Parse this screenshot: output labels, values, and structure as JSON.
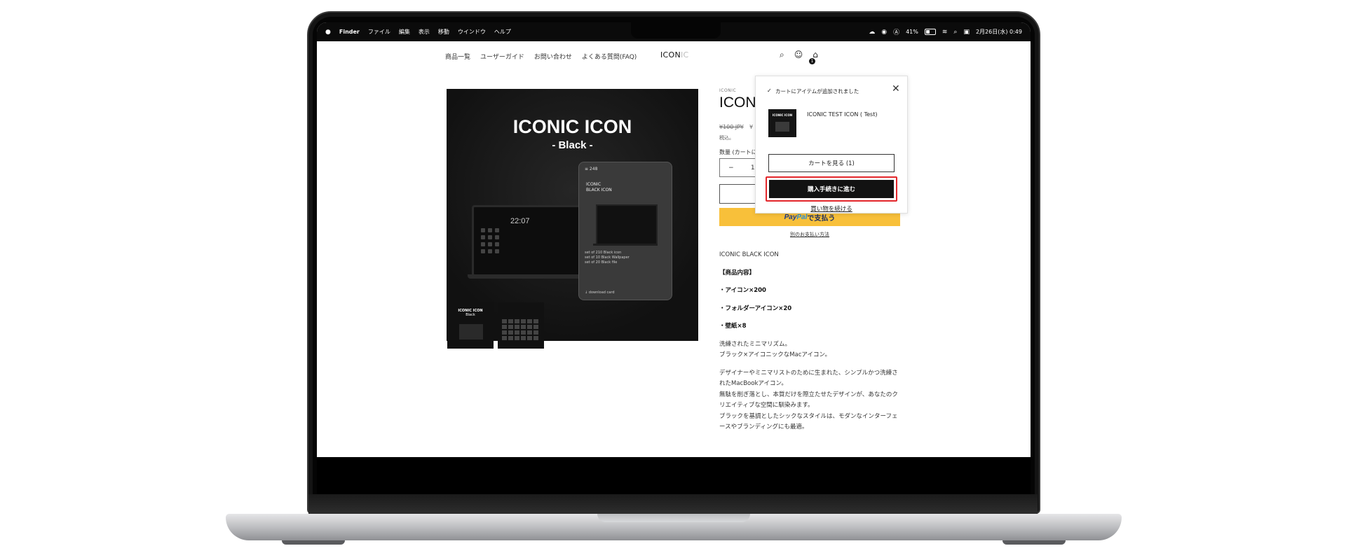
{
  "menubar": {
    "app": "Finder",
    "menus": [
      "ファイル",
      "編集",
      "表示",
      "移動",
      "ウインドウ",
      "ヘルプ"
    ],
    "battery": "41%",
    "datetime": "2月26日(水) 0:49"
  },
  "header": {
    "nav": [
      "商品一覧",
      "ユーザーガイド",
      "お問い合わせ",
      "よくある質問(FAQ)"
    ],
    "logo_main": "ICON",
    "logo_faded": "IC",
    "cart_count": "1"
  },
  "product_image": {
    "title": "ICONIC ICON",
    "subtitle": "- Black -",
    "mac_time": "22:07",
    "phone_top": "≡ 248",
    "phone_label_1": "ICONIC",
    "phone_label_2": "BLACK ICON",
    "phone_line_1": "set of 210 Black icon",
    "phone_line_2": "set of 10 Black Wallpaper",
    "phone_line_3": "set of 20 Black file",
    "phone_download": "↓ download card"
  },
  "thumbs": {
    "t1_title": "ICONIC ICON",
    "t1_sub": "Black"
  },
  "product": {
    "vendor": "ICONIC",
    "title": "ICON",
    "price_old": "¥100 JPY",
    "price_new": "¥",
    "tax": "税込。",
    "qty_label": "数量 (カートに",
    "qty_minus": "−",
    "qty_value": "1",
    "paypal_pay": "Pay",
    "paypal_pal": "Pal",
    "paypal_suffix": "で支払う",
    "other_payment": "別のお支払い方法",
    "desc_name": "ICONIC BLACK ICON",
    "desc_header": "【商品内容】",
    "desc_item1": "・アイコン×200",
    "desc_item2": "・フォルダーアイコン×20",
    "desc_item3": "・壁紙×8",
    "desc_p1a": "洗練されたミニマリズム。",
    "desc_p1b": "ブラック×アイコニックなMacアイコン。",
    "desc_p2a": "デザイナーやミニマリストのために生まれた、シンプルかつ洗練されたMacBookアイコン。",
    "desc_p2b": "無駄を削ぎ落とし、本質だけを際立たせたデザインが、あなたのクリエイティブな空間に馴染みます。",
    "desc_p2c": "ブラックを基調としたシックなスタイルは、モダンなインターフェースやブランディングにも最適。"
  },
  "popup": {
    "message": "カートにアイテムが追加されました",
    "thumb_title": "ICONIC ICON",
    "item_name": "ICONIC TEST ICON ( Test)",
    "view_cart": "カートを見る (1)",
    "checkout": "購入手続きに進む",
    "continue": "買い物を続ける"
  },
  "colors": {
    "highlight": "#e3262b",
    "paypal_bg": "#f8c03a"
  }
}
